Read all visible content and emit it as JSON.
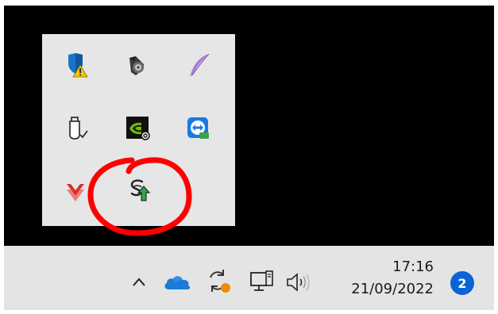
{
  "taskbar": {
    "clock": {
      "time": "17:16",
      "date": "21/09/2022"
    },
    "notification_count": "2",
    "icons": [
      "chevron-up-icon",
      "onedrive-icon",
      "sync-warning-icon",
      "network-icon",
      "volume-icon"
    ]
  },
  "tray_flyout": {
    "icons": [
      "windows-security-warning-icon",
      "speaker-icon",
      "feather-icon",
      "usb-safely-remove-icon",
      "nvidia-icon",
      "teamviewer-icon",
      "antivirus-v-icon",
      "update-notifier-icon"
    ]
  },
  "colors": {
    "desktop": "#000000",
    "flyout": "#e6e6e6",
    "taskbar": "#e4e4e4",
    "accent": "#0a64d6",
    "highlight": "#ff0000"
  }
}
